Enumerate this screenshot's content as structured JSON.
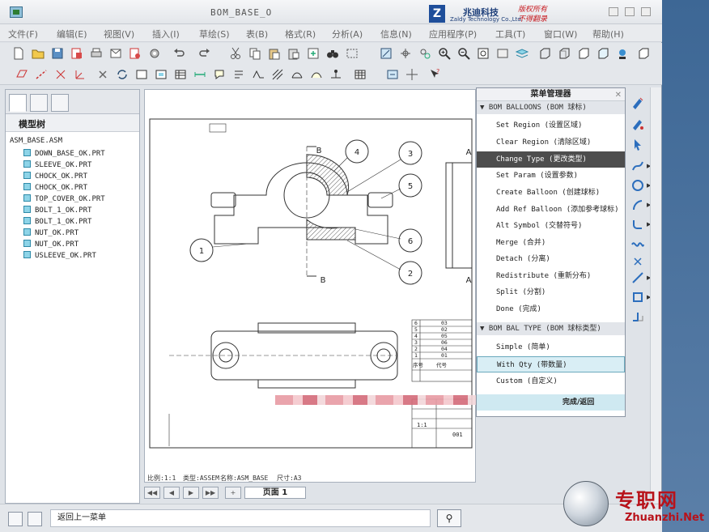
{
  "window": {
    "title": "BOM_BASE_O",
    "brand_cn": "兆迪科技",
    "brand_en": "Zaldy Technology Co.,Ltd.",
    "brand_red_1": "版权所有",
    "brand_red_2": "不得翻录"
  },
  "menubar": [
    "文件(F)",
    "编辑(E)",
    "视图(V)",
    "插入(I)",
    "草绘(S)",
    "表(B)",
    "格式(R)",
    "分析(A)",
    "信息(N)",
    "应用程序(P)",
    "工具(T)",
    "窗口(W)",
    "帮助(H)"
  ],
  "model_tree": {
    "header": "模型树",
    "root": "ASM_BASE.ASM",
    "items": [
      "DOWN_BASE_OK.PRT",
      "SLEEVE_OK.PRT",
      "CHOCK_OK.PRT",
      "CHOCK_OK.PRT",
      "TOP_COVER_OK.PRT",
      "BOLT_1_OK.PRT",
      "BOLT_1_OK.PRT",
      "NUT_OK.PRT",
      "NUT_OK.PRT",
      "USLEEVE_OK.PRT"
    ]
  },
  "drawing": {
    "balloons": [
      "1",
      "2",
      "3",
      "4",
      "5",
      "6"
    ],
    "section_labels": [
      "B",
      "B",
      "A",
      "A"
    ],
    "bom_rows": [
      {
        "idx": "6",
        "code": "03"
      },
      {
        "idx": "5",
        "code": "02"
      },
      {
        "idx": "4",
        "code": "05"
      },
      {
        "idx": "3",
        "code": "06"
      },
      {
        "idx": "2",
        "code": "04"
      },
      {
        "idx": "1",
        "code": "01"
      }
    ],
    "bom_header_idx": "序号",
    "bom_header_code": "代号",
    "title_block_code": "001",
    "title_block_scale": "1:1"
  },
  "status_strip": {
    "scale": "比例:1:1",
    "type": "类型:ASSEM",
    "name": "名称:ASM_BASE",
    "size": "尺寸:A3"
  },
  "pager": {
    "page_label": "页面 1"
  },
  "menu_manager": {
    "title": "菜单管理器",
    "section1": "BOM BALLOONS (BOM 球标)",
    "items1": [
      "Set Region (设置区域)",
      "Clear Region (清除区域)",
      "Change Type (更改类型)",
      "Set Param (设置参数)",
      "Create Balloon (创建球标)",
      "Add Ref Balloon (添加参考球标)",
      "Alt Symbol (交替符号)",
      "Merge (合并)",
      "Detach (分离)",
      "Redistribute (重新分布)",
      "Split (分割)",
      "Done (完成)"
    ],
    "highlighted_index": 2,
    "section2": "BOM BAL TYPE (BOM 球标类型)",
    "items2": [
      "Simple (简单)",
      "With Qty (带数量)",
      "Custom (自定义)"
    ],
    "selected_index2": 1,
    "done_return": "完成/返回"
  },
  "bottombar": {
    "message": "返回上一菜单"
  },
  "watermark": {
    "cn": "专职网",
    "en": "Zhuanzhi.Net"
  },
  "colors": {
    "highlight": "#4d4d4d",
    "selection": "#d9eef5",
    "watermark_red": "#b8121a",
    "desktop": "#4a6f99"
  }
}
